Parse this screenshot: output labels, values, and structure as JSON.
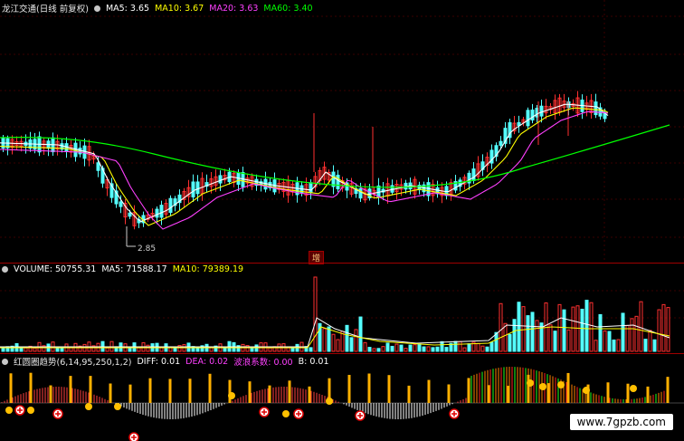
{
  "price_header": {
    "stock": "龙江交通(日线 前复权)",
    "ma5_label": "MA5:",
    "ma5": "3.65",
    "ma10_label": "MA10:",
    "ma10": "3.67",
    "ma20_label": "MA20:",
    "ma20": "3.63",
    "ma60_label": "MA60:",
    "ma60": "3.40"
  },
  "low_marker": "2.85",
  "badge": "增",
  "volume_header": {
    "volume_label": "VOLUME:",
    "volume": "50755.31",
    "ma5_label": "MA5:",
    "ma5": "71588.17",
    "ma10_label": "MA10:",
    "ma10": "79389.19"
  },
  "indicator_header": {
    "name": "红圆圈趋势(6,14,95,250,1,2)",
    "diff_label": "DIFF:",
    "diff": "0.01",
    "dea_label": "DEA:",
    "dea": "0.02",
    "wave_label": "波浪系数:",
    "wave": "0.00",
    "b_label": "B:",
    "b": "0.01"
  },
  "watermark": "www.7gpzb.com",
  "colors": {
    "up": "#ff3030",
    "down": "#54ffff",
    "ma5": "#ffffff",
    "ma10": "#ffff00",
    "ma20": "#ff40ff",
    "ma60": "#00ff00",
    "separator": "#a00000"
  }
}
